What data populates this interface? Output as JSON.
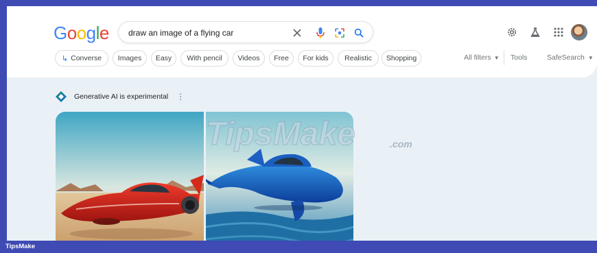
{
  "logo": {
    "letters": [
      "G",
      "o",
      "o",
      "g",
      "l",
      "e"
    ],
    "colors": [
      "#4285f4",
      "#ea4335",
      "#fbbc05",
      "#4285f4",
      "#34a853",
      "#ea4335"
    ]
  },
  "search": {
    "query": "draw an image of a flying car"
  },
  "chips": [
    {
      "label": "Converse",
      "icon": "return-arrow-icon"
    },
    {
      "label": "Images"
    },
    {
      "label": "Easy"
    },
    {
      "label": "With pencil"
    },
    {
      "label": "Videos"
    },
    {
      "label": "Free"
    },
    {
      "label": "For kids"
    },
    {
      "label": "Realistic"
    },
    {
      "label": "Shopping"
    }
  ],
  "filters": {
    "all_filters": "All filters",
    "tools": "Tools",
    "safesearch": "SafeSearch"
  },
  "ai": {
    "label": "Generative AI is experimental",
    "more": "⋮"
  },
  "watermark": {
    "text": "TipsMake",
    "suffix": ".com"
  },
  "bottom_bar": {
    "label": "TipsMake"
  },
  "colors": {
    "accent": "#1a73e8",
    "frame": "#3f4ab4",
    "background": "#eaf1f6"
  }
}
